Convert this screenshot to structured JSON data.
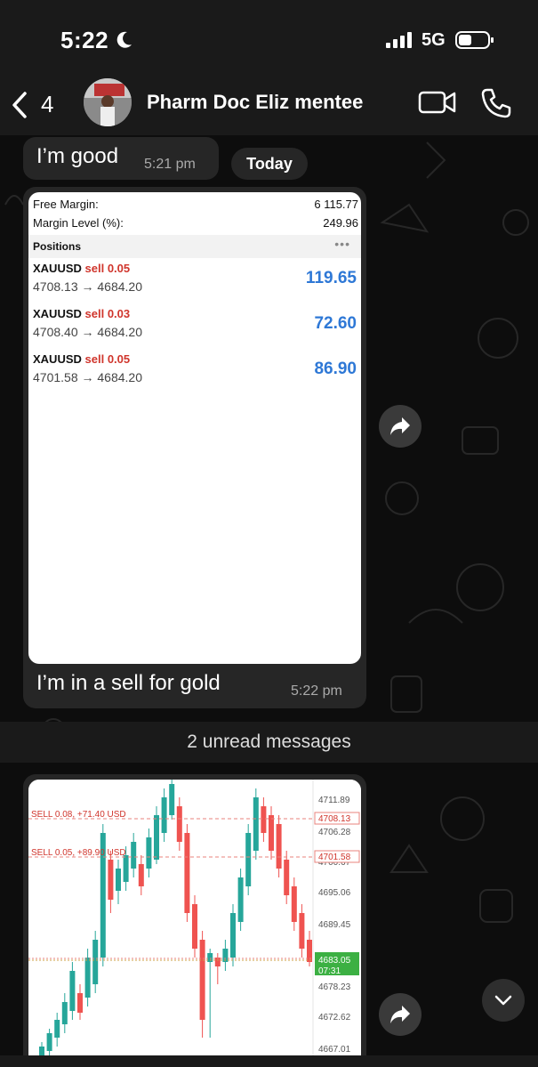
{
  "status_bar": {
    "time": "5:22",
    "network": "5G"
  },
  "header": {
    "back_count": "4",
    "chat_name": "Pharm Doc Eliz mentee"
  },
  "messages": {
    "good": {
      "text": "I’m good",
      "time": "5:21 pm"
    },
    "date_chip": "Today",
    "trade_image": {
      "free_margin_label": "Free Margin:",
      "free_margin_value": "6 115.77",
      "margin_level_label": "Margin Level (%):",
      "margin_level_value": "249.96",
      "positions_label": "Positions",
      "positions": [
        {
          "symbol": "XAUUSD",
          "side": "sell 0.05",
          "range": "4708.13 → 4684.20",
          "pnl": "119.65"
        },
        {
          "symbol": "XAUUSD",
          "side": "sell 0.03",
          "range": "4708.40 → 4684.20",
          "pnl": "72.60"
        },
        {
          "symbol": "XAUUSD",
          "side": "sell 0.05",
          "range": "4701.58 → 4684.20",
          "pnl": "86.90"
        }
      ],
      "caption": "I’m in a sell for gold",
      "time": "5:22 pm"
    },
    "unread_label": "2 unread messages",
    "chart_image": {
      "price_labels": [
        "4711.89",
        "4706.28",
        "4700.67",
        "4695.06",
        "4689.45",
        "4678.23",
        "4672.62",
        "4667.01"
      ],
      "line_tags": [
        "4708.13",
        "4701.58"
      ],
      "current_price": "4683.05",
      "countdown": "07:31",
      "order_line_1": "SELL 0.08, +71.40 USD",
      "order_line_2": "SELL 0.05, +89.90 USD"
    }
  },
  "colors": {
    "bubble": "#262626",
    "pnl_blue": "#2e78d6",
    "sell_red": "#d0352c",
    "bull": "#26a69a",
    "bear": "#ef5350"
  }
}
